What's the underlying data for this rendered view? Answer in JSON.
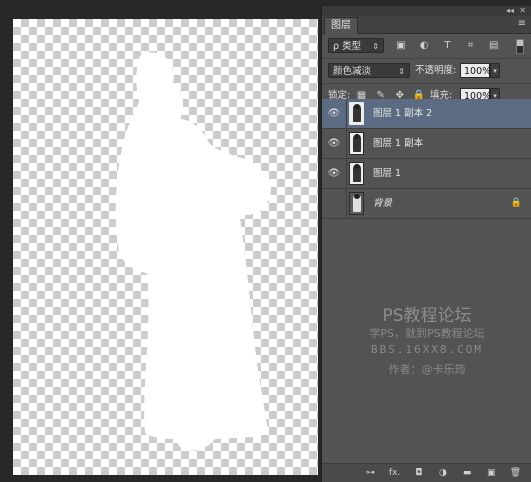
{
  "panel": {
    "collapse_glyph": "◂◂",
    "close_glyph": "✕",
    "tab_label": "图层",
    "menu_glyph": "≡",
    "filter": {
      "search_glyph": "ρ",
      "label": "类型"
    },
    "filter_icons": [
      "▣",
      "◐",
      "T",
      "⌗",
      "▤"
    ],
    "blend_mode": "颜色减淡",
    "opacity_label": "不透明度:",
    "opacity_value": "100%",
    "lock_label": "锁定:",
    "lock_icons": [
      "▦",
      "✎",
      "✥",
      "🔒"
    ],
    "fill_label": "填充:",
    "fill_value": "100%"
  },
  "layers": [
    {
      "name": "图层 1 副本 2",
      "visible": true,
      "selected": true
    },
    {
      "name": "图层 1 副本",
      "visible": true,
      "selected": false
    },
    {
      "name": "图层 1",
      "visible": true,
      "selected": false
    },
    {
      "name": "背景",
      "visible": false,
      "selected": false,
      "locked": true
    }
  ],
  "watermark": {
    "line1": "PS教程论坛",
    "line2": "学PS，就到PS教程论坛",
    "line3": "BBS.16XX8.COM",
    "line4": "作者：@卡乐筠"
  },
  "bottom_icons": [
    "⊶",
    "fx.",
    "◘",
    "◑",
    "▬",
    "▣",
    "🗑"
  ],
  "colors": {
    "panel_bg": "#535353",
    "selected_layer": "#5b6b82",
    "app_bg": "#282828"
  }
}
